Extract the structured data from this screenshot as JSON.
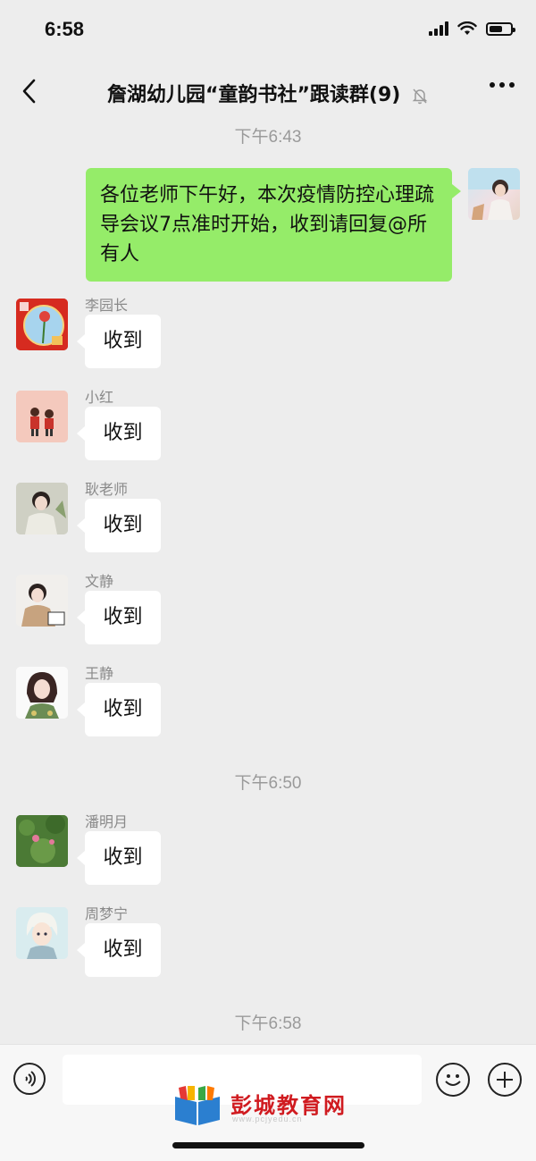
{
  "status_bar": {
    "time": "6:58"
  },
  "header": {
    "title": "詹湖幼儿园“童韵书社”跟读群(9)"
  },
  "timestamps": [
    "下午6:43",
    "下午6:50",
    "下午6:58"
  ],
  "self_message": {
    "text": "各位老师下午好，本次疫情防控心理疏导会议7点准时开始，收到请回复@所有人"
  },
  "messages": [
    {
      "sender": "李园长",
      "text": "收到"
    },
    {
      "sender": "小红",
      "text": "收到"
    },
    {
      "sender": "耿老师",
      "text": "收到"
    },
    {
      "sender": "文静",
      "text": "收到"
    },
    {
      "sender": "王静",
      "text": "收到"
    },
    {
      "sender": "潘明月",
      "text": "收到"
    },
    {
      "sender": "周梦宁",
      "text": "收到"
    }
  ],
  "watermark": {
    "brand": "彭城教育网",
    "url": "www.pcjyedu.cn"
  },
  "icons": {
    "back": "chevron-left-icon",
    "mute": "bell-off-icon",
    "more": "more-icon",
    "voice": "voice-icon",
    "emoji": "emoji-icon",
    "plus": "plus-icon"
  }
}
